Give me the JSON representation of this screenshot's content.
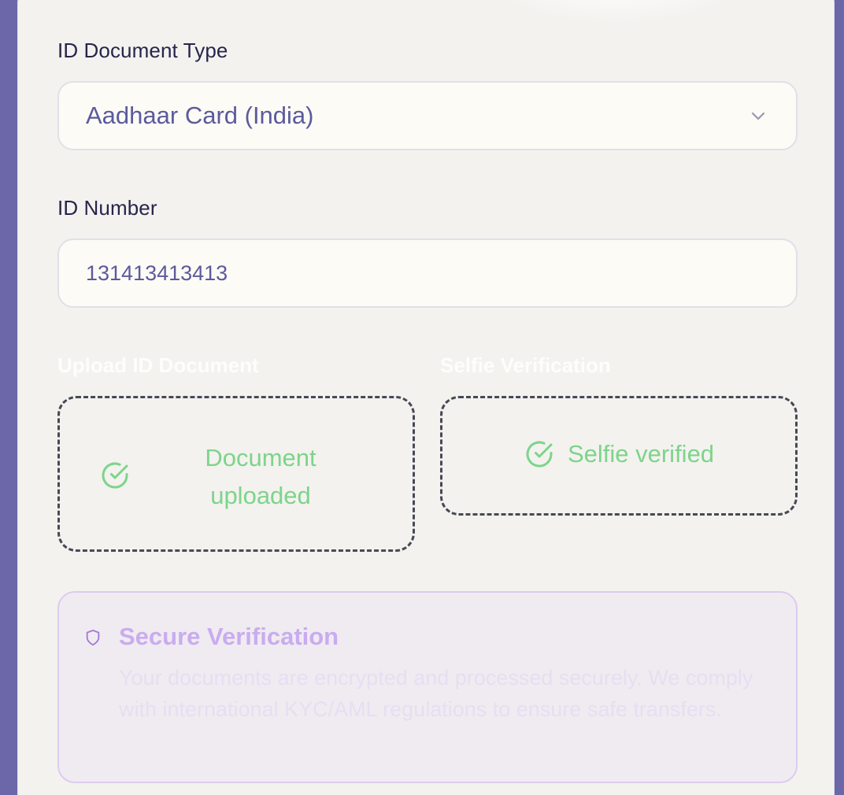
{
  "form": {
    "id_type": {
      "label": "ID Document Type",
      "selected_value": "Aadhaar Card (India)",
      "icon": "chevron-down-icon"
    },
    "id_number": {
      "label": "ID Number",
      "value": "131413413413"
    },
    "upload_document": {
      "label": "Upload ID Document",
      "status_line1": "Document",
      "status_line2": "uploaded",
      "icon": "check-circle-icon",
      "status_color": "#7dd48a"
    },
    "selfie": {
      "label": "Selfie Verification",
      "status": "Selfie verified",
      "icon": "check-circle-icon",
      "status_color": "#7dd48a"
    }
  },
  "secure_notice": {
    "icon": "shield-icon",
    "title": "Secure Verification",
    "text": "Your documents are encrypted and processed securely. We comply with international KYC/AML regulations to ensure safe transfers."
  },
  "colors": {
    "page_background": "#6b67a8",
    "card_background": "#f3f2ef",
    "accent_purple": "#c9acf0",
    "success_green": "#7dd48a"
  }
}
